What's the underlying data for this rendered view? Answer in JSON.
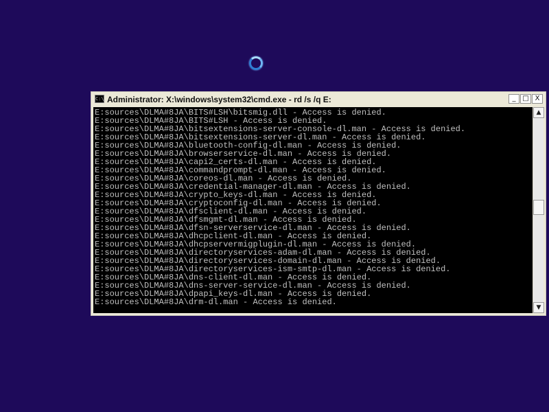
{
  "window": {
    "title": "Administrator: X:\\windows\\system32\\cmd.exe - rd  /s /q E:",
    "icon_label": "C:\\",
    "buttons": {
      "minimize": "_",
      "maximize": "□",
      "close": "X"
    }
  },
  "console": {
    "lines": [
      "E:sources\\DLMA#8JA\\BITS#LSH\\bitsmig.dll - Access is denied.",
      "E:sources\\DLMA#8JA\\BITS#LSH - Access is denied.",
      "E:sources\\DLMA#8JA\\bitsextensions-server-console-dl.man - Access is denied.",
      "E:sources\\DLMA#8JA\\bitsextensions-server-dl.man - Access is denied.",
      "E:sources\\DLMA#8JA\\bluetooth-config-dl.man - Access is denied.",
      "E:sources\\DLMA#8JA\\browserservice-dl.man - Access is denied.",
      "E:sources\\DLMA#8JA\\capi2_certs-dl.man - Access is denied.",
      "E:sources\\DLMA#8JA\\commandprompt-dl.man - Access is denied.",
      "E:sources\\DLMA#8JA\\coreos-dl.man - Access is denied.",
      "E:sources\\DLMA#8JA\\credential-manager-dl.man - Access is denied.",
      "E:sources\\DLMA#8JA\\crypto_keys-dl.man - Access is denied.",
      "E:sources\\DLMA#8JA\\cryptoconfig-dl.man - Access is denied.",
      "E:sources\\DLMA#8JA\\dfsclient-dl.man - Access is denied.",
      "E:sources\\DLMA#8JA\\dfsmgmt-dl.man - Access is denied.",
      "E:sources\\DLMA#8JA\\dfsn-serverservice-dl.man - Access is denied.",
      "E:sources\\DLMA#8JA\\dhcpclient-dl.man - Access is denied.",
      "E:sources\\DLMA#8JA\\dhcpservermigplugin-dl.man - Access is denied.",
      "E:sources\\DLMA#8JA\\directoryservices-adam-dl.man - Access is denied.",
      "E:sources\\DLMA#8JA\\directoryservices-domain-dl.man - Access is denied.",
      "E:sources\\DLMA#8JA\\directoryservices-ism-smtp-dl.man - Access is denied.",
      "E:sources\\DLMA#8JA\\dns-client-dl.man - Access is denied.",
      "E:sources\\DLMA#8JA\\dns-server-service-dl.man - Access is denied.",
      "E:sources\\DLMA#8JA\\dpapi_keys-dl.man - Access is denied.",
      "E:sources\\DLMA#8JA\\drm-dl.man - Access is denied."
    ]
  },
  "scrollbar": {
    "up_glyph": "▲",
    "down_glyph": "▼"
  },
  "colors": {
    "desktop": "#1e0a5a",
    "console_bg": "#000000",
    "console_text": "#c0c0c0",
    "spinner": "#6fb6f5"
  }
}
